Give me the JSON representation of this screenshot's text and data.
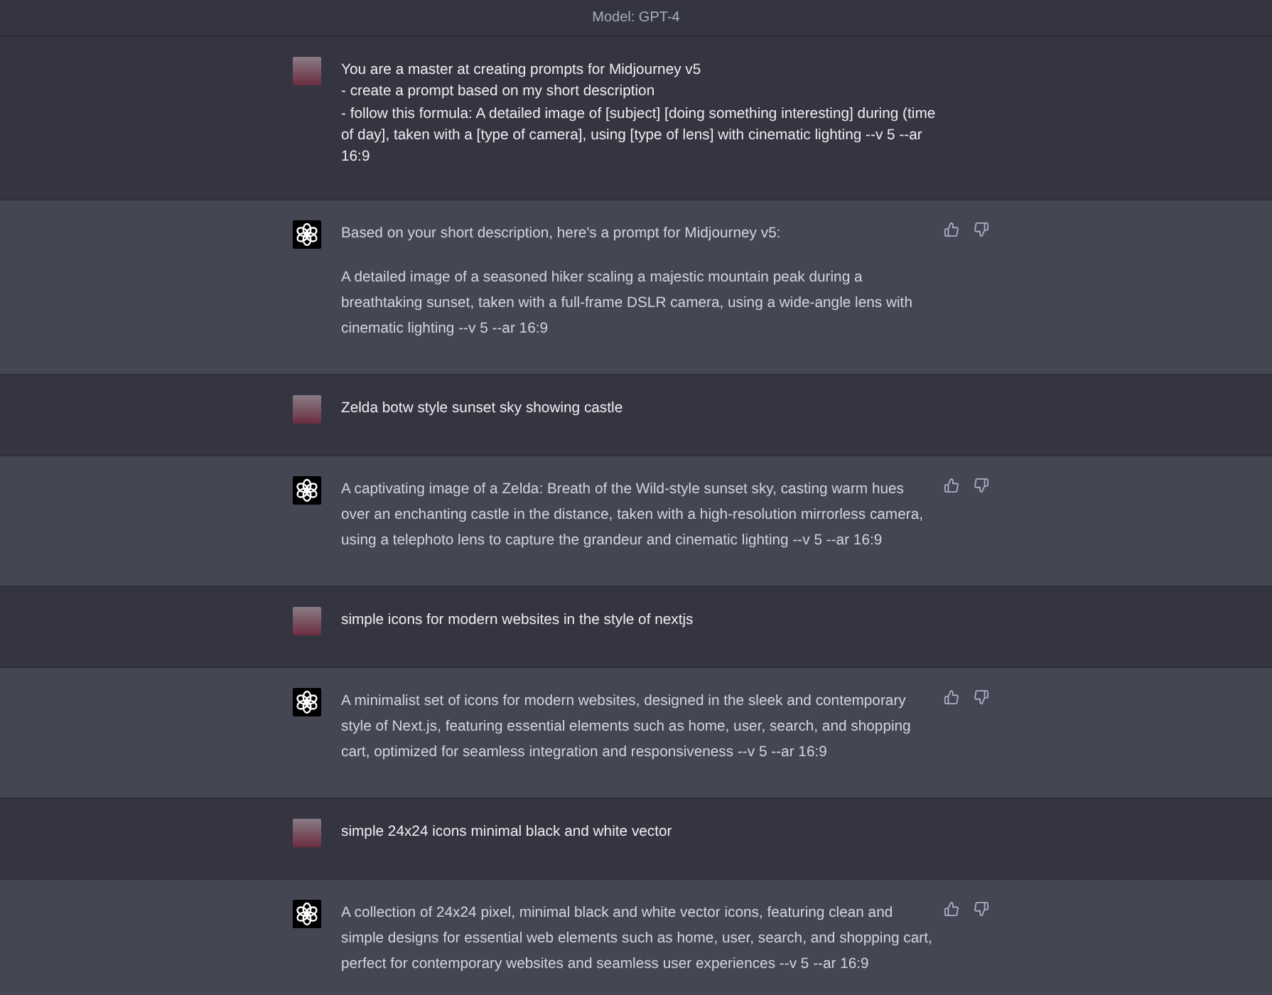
{
  "header": {
    "model_label": "Model: GPT-4"
  },
  "messages": [
    {
      "kind": "user",
      "paragraphs": [
        "You are a master at creating prompts for Midjourney v5\n- create a prompt based on my short description\n- follow this formula: A detailed image of [subject] [doing something interesting] during (time of day], taken with a [type of camera], using [type of lens] with cinematic lighting --v 5 --ar 16:9"
      ]
    },
    {
      "kind": "assistant",
      "paragraphs": [
        "Based on your short description, here's a prompt for Midjourney v5:",
        "A detailed image of a seasoned hiker scaling a majestic mountain peak during a breathtaking sunset, taken with a full-frame DSLR camera, using a wide-angle lens with cinematic lighting --v 5 --ar 16:9"
      ]
    },
    {
      "kind": "user",
      "paragraphs": [
        "Zelda botw style sunset sky showing castle"
      ]
    },
    {
      "kind": "assistant",
      "paragraphs": [
        "A captivating image of a Zelda: Breath of the Wild-style sunset sky, casting warm hues over an enchanting castle in the distance, taken with a high-resolution mirrorless camera, using a telephoto lens to capture the grandeur and cinematic lighting --v 5 --ar 16:9"
      ]
    },
    {
      "kind": "user",
      "paragraphs": [
        "simple icons for modern websites in the style of nextjs"
      ]
    },
    {
      "kind": "assistant",
      "paragraphs": [
        "A minimalist set of icons for modern websites, designed in the sleek and contemporary style of Next.js, featuring essential elements such as home, user, search, and shopping cart, optimized for seamless integration and responsiveness --v 5 --ar 16:9"
      ]
    },
    {
      "kind": "user",
      "paragraphs": [
        "simple 24x24 icons minimal black and white vector"
      ]
    },
    {
      "kind": "assistant",
      "paragraphs": [
        "A collection of 24x24 pixel, minimal black and white vector icons, featuring clean and simple designs for essential web elements such as home, user, search, and shopping cart, perfect for contemporary websites and seamless user experiences --v 5 --ar 16:9"
      ]
    }
  ]
}
